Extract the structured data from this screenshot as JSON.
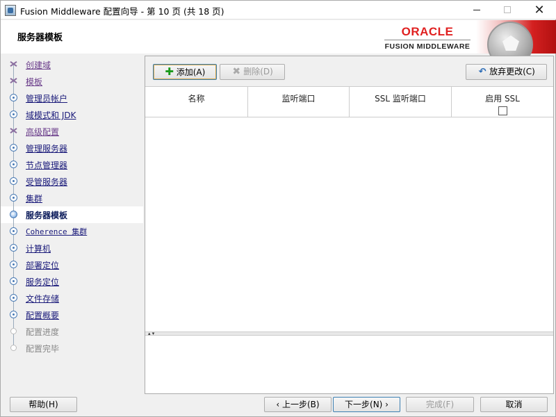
{
  "window": {
    "title": "Fusion Middleware 配置向导 - 第 10 页 (共 18 页)",
    "controls": {
      "minimize": "",
      "maximize": "",
      "close": "✕"
    }
  },
  "header": {
    "page_title": "服务器模板",
    "logo_oracle": "ORACLE",
    "logo_product": "FUSION MIDDLEWARE"
  },
  "steps": [
    {
      "label": "创建域",
      "state": "done"
    },
    {
      "label": "模板",
      "state": "done"
    },
    {
      "label": "管理员帐户",
      "state": "future"
    },
    {
      "label": "域模式和 JDK",
      "state": "future"
    },
    {
      "label": "高级配置",
      "state": "done"
    },
    {
      "label": "管理服务器",
      "state": "future"
    },
    {
      "label": "节点管理器",
      "state": "future"
    },
    {
      "label": "受管服务器",
      "state": "future"
    },
    {
      "label": "集群",
      "state": "future"
    },
    {
      "label": "服务器模板",
      "state": "current"
    },
    {
      "label": "Coherence 集群",
      "state": "future"
    },
    {
      "label": "计算机",
      "state": "future"
    },
    {
      "label": "部署定位",
      "state": "future"
    },
    {
      "label": "服务定位",
      "state": "future"
    },
    {
      "label": "文件存储",
      "state": "future"
    },
    {
      "label": "配置概要",
      "state": "future"
    },
    {
      "label": "配置进度",
      "state": "disabled"
    },
    {
      "label": "配置完毕",
      "state": "disabled"
    }
  ],
  "toolbar": {
    "add_label": "添加(A)",
    "delete_label": "删除(D)",
    "discard_label": "放弃更改(C)"
  },
  "table": {
    "columns": [
      "名称",
      "监听端口",
      "SSL 监听端口",
      "启用 SSL"
    ],
    "rows": []
  },
  "footer": {
    "help": "帮助(H)",
    "back": "上一步(B)",
    "next": "下一步(N)",
    "finish": "完成(F)",
    "cancel": "取消"
  },
  "colors": {
    "oracle_red": "#e02020",
    "nav_link": "#1a1a7a",
    "nav_visited": "#6a3c8a"
  }
}
